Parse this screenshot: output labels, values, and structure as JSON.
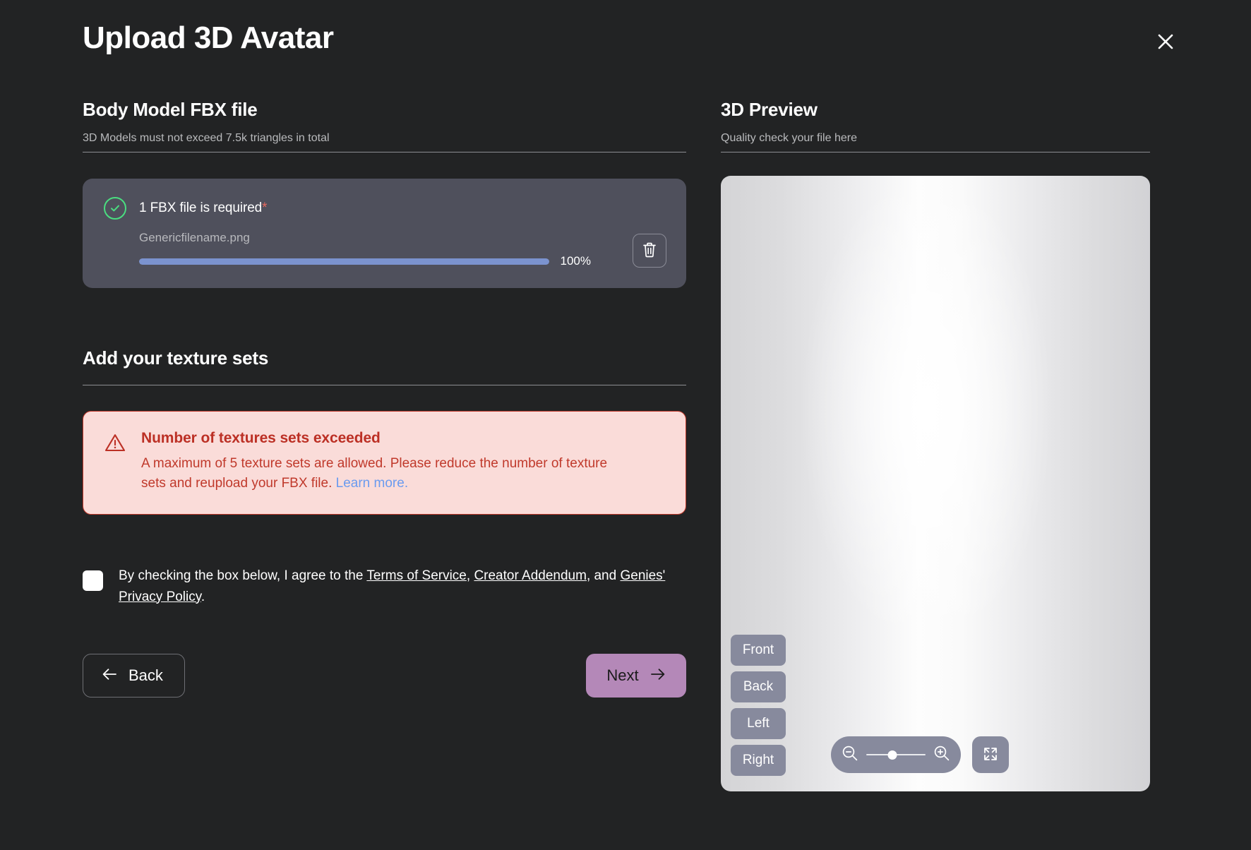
{
  "modal": {
    "title": "Upload 3D Avatar",
    "close_icon": "close-icon"
  },
  "body_model": {
    "title": "Body Model FBX file",
    "subtitle": "3D Models must not exceed 7.5k triangles in total",
    "file_card": {
      "status_icon": "check-circle-icon",
      "requirement_label": "1 FBX file is required",
      "required_marker": "*",
      "file_name": "Genericfilename.png",
      "progress_percent": "100%",
      "progress_value": 100,
      "delete_icon": "trash-icon"
    }
  },
  "texture_sets": {
    "title": "Add your texture sets",
    "alert": {
      "icon": "warning-triangle-icon",
      "title": "Number of textures sets exceeded",
      "body_before_link": "A maximum of 5 texture sets are allowed. Please reduce the number of texture sets and reupload your FBX file. ",
      "link_label": "Learn more."
    }
  },
  "terms": {
    "checkbox_checked": false,
    "prefix": "By checking the box below, I agree to the ",
    "link_terms": "Terms of Service",
    "sep1": ", ",
    "link_addendum": "Creator Addendum",
    "sep2": ", and ",
    "link_privacy": "Genies' Privacy Policy",
    "suffix": "."
  },
  "footer": {
    "back_label": "Back",
    "back_icon": "arrow-left-icon",
    "next_label": "Next",
    "next_icon": "arrow-right-icon"
  },
  "preview": {
    "title": "3D Preview",
    "subtitle": "Quality check your file here",
    "view_buttons": [
      {
        "label": "Front",
        "name": "view-front-button"
      },
      {
        "label": "Back",
        "name": "view-back-button"
      },
      {
        "label": "Left",
        "name": "view-left-button"
      },
      {
        "label": "Right",
        "name": "view-right-button"
      }
    ],
    "zoom_out_icon": "zoom-out-icon",
    "zoom_in_icon": "zoom-in-icon",
    "fullscreen_icon": "fullscreen-icon",
    "zoom_slider_value": 44
  },
  "colors": {
    "background": "#222324",
    "card": "#4f505c",
    "progress": "#7b93cf",
    "success": "#4ade80",
    "required_star": "#e8695f",
    "alert_bg": "#fadcd9",
    "alert_border": "#c0392b",
    "alert_text": "#c0392b",
    "alert_link": "#6b9bef",
    "next_button": "#b488b8",
    "view_button": "#878a9d"
  }
}
